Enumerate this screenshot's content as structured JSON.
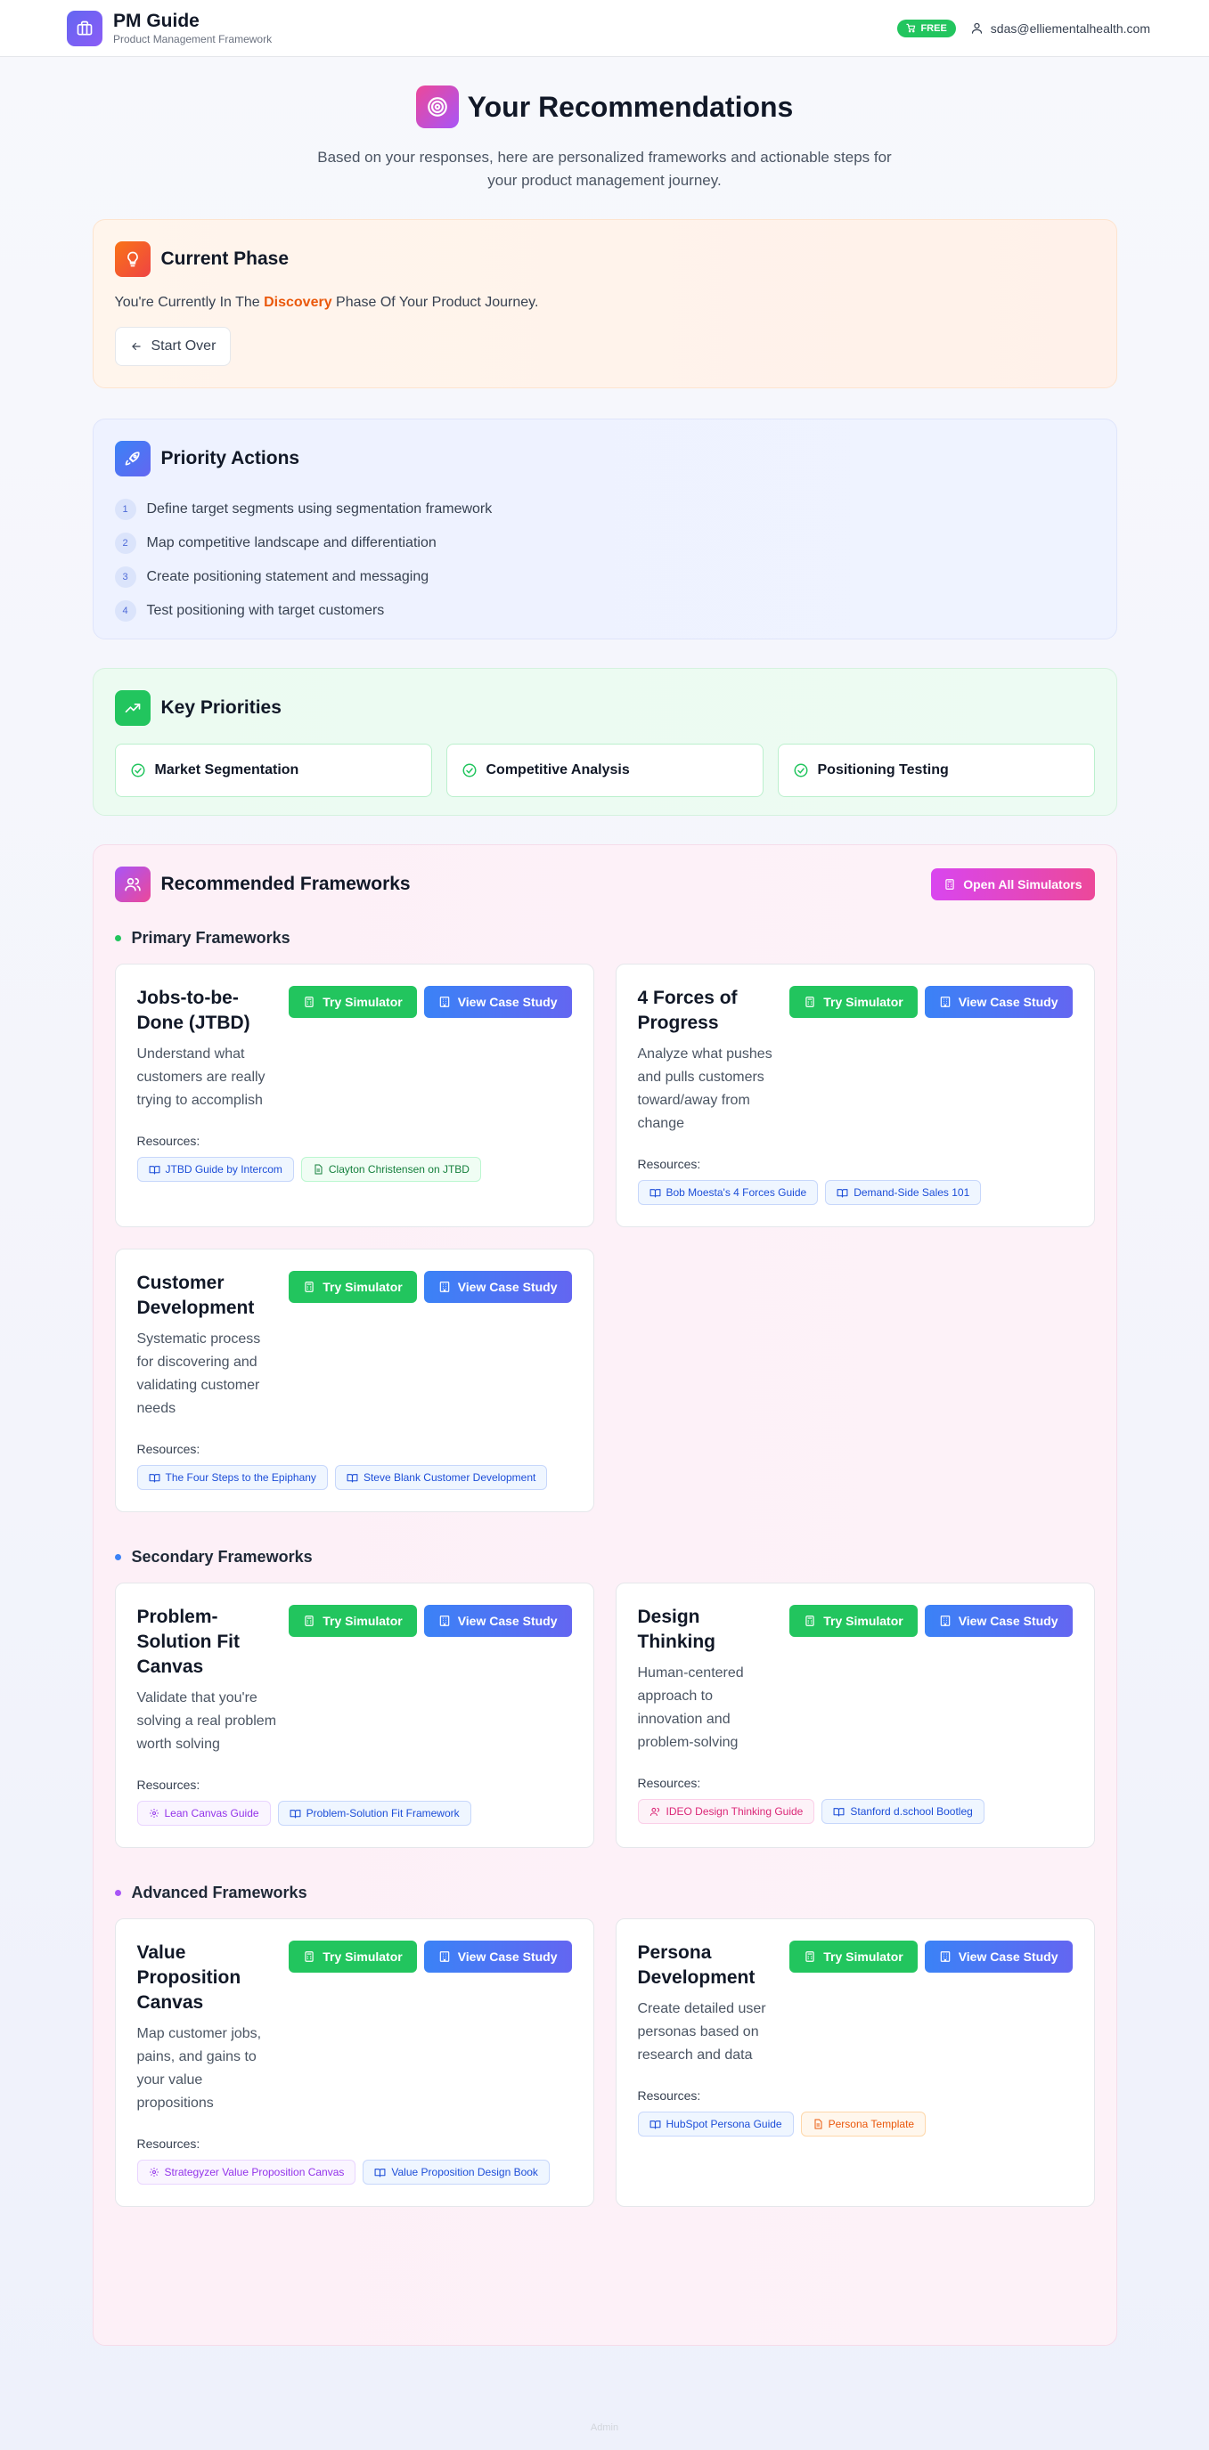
{
  "header": {
    "app_title": "PM Guide",
    "app_subtitle": "Product Management Framework",
    "plan_badge": "FREE",
    "user_email": "sdas@elliementalhealth.com"
  },
  "hero": {
    "title": "Your Recommendations",
    "subtitle": "Based on your responses, here are personalized frameworks and actionable steps for your product management journey."
  },
  "phase": {
    "title": "Current Phase",
    "text_before": "You're Currently In The ",
    "phase_name": "Discovery",
    "text_after": " Phase Of Your Product Journey.",
    "start_over_label": "Start Over"
  },
  "priority_actions": {
    "title": "Priority Actions",
    "items": [
      {
        "num": "1",
        "text": "Define target segments using segmentation framework"
      },
      {
        "num": "2",
        "text": "Map competitive landscape and differentiation"
      },
      {
        "num": "3",
        "text": "Create positioning statement and messaging"
      },
      {
        "num": "4",
        "text": "Test positioning with target customers"
      }
    ]
  },
  "key_priorities": {
    "title": "Key Priorities",
    "items": [
      "Market Segmentation",
      "Competitive Analysis",
      "Positioning Testing"
    ]
  },
  "frameworks": {
    "title": "Recommended Frameworks",
    "open_all_label": "Open All Simulators",
    "try_label": "Try Simulator",
    "case_label": "View Case Study",
    "resources_label": "Resources:",
    "groups": {
      "primary": {
        "title": "Primary Frameworks",
        "dot_color": "#22c55e",
        "items": [
          {
            "name": "Jobs-to-be-Done (JTBD)",
            "desc": "Understand what customers are really trying to accomplish",
            "resources": [
              {
                "label": "JTBD Guide by Intercom",
                "color": "blue",
                "icon": "book-icon"
              },
              {
                "label": "Clayton Christensen on JTBD",
                "color": "green",
                "icon": "document-icon"
              }
            ]
          },
          {
            "name": "4 Forces of Progress",
            "desc": "Analyze what pushes and pulls customers toward/away from change",
            "resources": [
              {
                "label": "Bob Moesta's 4 Forces Guide",
                "color": "blue",
                "icon": "book-icon"
              },
              {
                "label": "Demand-Side Sales 101",
                "color": "blue",
                "icon": "book-icon"
              }
            ]
          },
          {
            "name": "Customer Development",
            "desc": "Systematic process for discovering and validating customer needs",
            "resources": [
              {
                "label": "The Four Steps to the Epiphany",
                "color": "blue",
                "icon": "book-icon"
              },
              {
                "label": "Steve Blank Customer Development",
                "color": "blue",
                "icon": "book-icon"
              }
            ]
          }
        ]
      },
      "secondary": {
        "title": "Secondary Frameworks",
        "dot_color": "#3b82f6",
        "items": [
          {
            "name": "Problem-Solution Fit Canvas",
            "desc": "Validate that you're solving a real problem worth solving",
            "resources": [
              {
                "label": "Lean Canvas Guide",
                "color": "purple",
                "icon": "gear-icon"
              },
              {
                "label": "Problem-Solution Fit Framework",
                "color": "blue",
                "icon": "book-icon"
              }
            ]
          },
          {
            "name": "Design Thinking",
            "desc": "Human-centered approach to innovation and problem-solving",
            "resources": [
              {
                "label": "IDEO Design Thinking Guide",
                "color": "pink",
                "icon": "users-icon"
              },
              {
                "label": "Stanford d.school Bootleg",
                "color": "blue",
                "icon": "book-icon"
              }
            ]
          }
        ]
      },
      "advanced": {
        "title": "Advanced Frameworks",
        "dot_color": "#a855f7",
        "items": [
          {
            "name": "Value Proposition Canvas",
            "desc": "Map customer jobs, pains, and gains to your value propositions",
            "resources": [
              {
                "label": "Strategyzer Value Proposition Canvas",
                "color": "purple",
                "icon": "gear-icon"
              },
              {
                "label": "Value Proposition Design Book",
                "color": "blue",
                "icon": "book-icon"
              }
            ]
          },
          {
            "name": "Persona Development",
            "desc": "Create detailed user personas based on research and data",
            "resources": [
              {
                "label": "HubSpot Persona Guide",
                "color": "blue",
                "icon": "book-icon"
              },
              {
                "label": "Persona Template",
                "color": "orange",
                "icon": "document-icon"
              }
            ]
          }
        ]
      }
    }
  },
  "footer": {
    "text": "Admin"
  },
  "colors": {
    "accent_orange": "#ea580c",
    "accent_green": "#22c55e",
    "accent_blue": "#3b82f6",
    "accent_pink": "#ec4899"
  }
}
